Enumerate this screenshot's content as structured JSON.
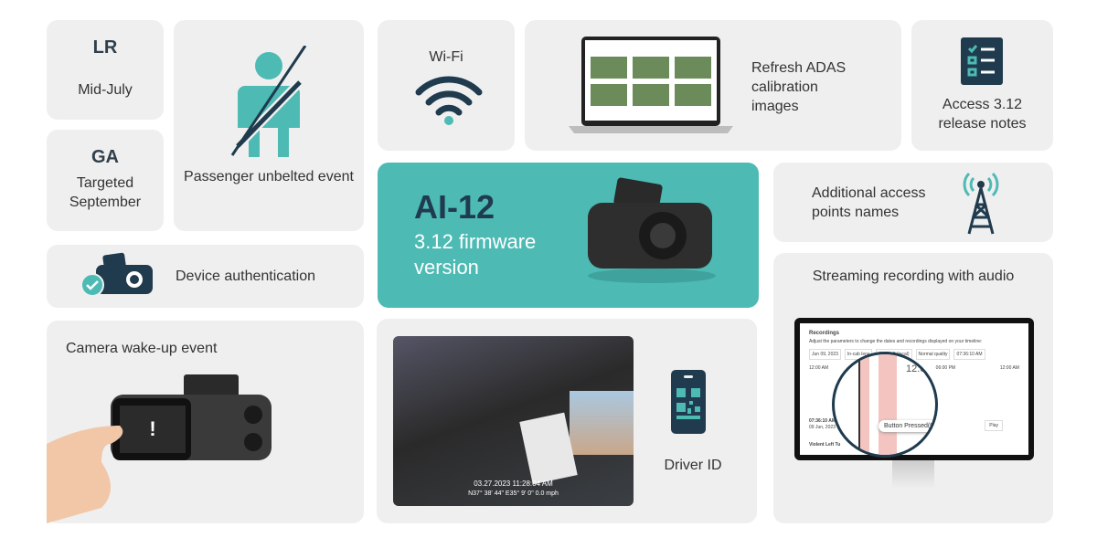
{
  "release": {
    "lr_label": "LR",
    "lr_date": "Mid-July",
    "ga_label": "GA",
    "ga_date_line1": "Targeted",
    "ga_date_line2": "September"
  },
  "features": {
    "passenger_unbelted": "Passenger unbelted event",
    "wifi": "Wi-Fi",
    "adas": "Refresh ADAS calibration images",
    "release_notes": "Access 3.12 release notes",
    "apn": "Additional access points names",
    "device_auth": "Device authentication",
    "wake_up": "Camera wake-up event",
    "driver_id": "Driver ID",
    "streaming": "Streaming recording with audio"
  },
  "hero": {
    "title": "AI-12",
    "subtitle_line1": "3.12 firmware",
    "subtitle_line2": "version",
    "color": "#4dbab4"
  },
  "dashcam_overlay": {
    "timestamp": "03.27.2023 11:28:04 AM",
    "coords": "N37° 38' 44\" E35° 9' 0\" 0.0 mph"
  },
  "recordings_screen": {
    "title": "Recordings",
    "description": "Adjust the parameters to change the dates and recordings displayed on your timeline:",
    "date": "Jun 09, 2023",
    "camera": "In-cab lens",
    "timezone": "GMT +0 (local)",
    "quality": "Normal quality",
    "time": "07:36:10 AM",
    "ticks": [
      "12:00 AM",
      "12:0",
      "06:00 PM",
      "12:00 AM"
    ],
    "current_time": "07:36:10 AM",
    "current_date": "09 Jun, 2023",
    "play": "Play",
    "event": "Button Pressed(08)",
    "event_row": "Violent Left Tu"
  },
  "colors": {
    "card": "#efefef",
    "icon": "#1f3b4d",
    "accent": "#4dbab4"
  }
}
